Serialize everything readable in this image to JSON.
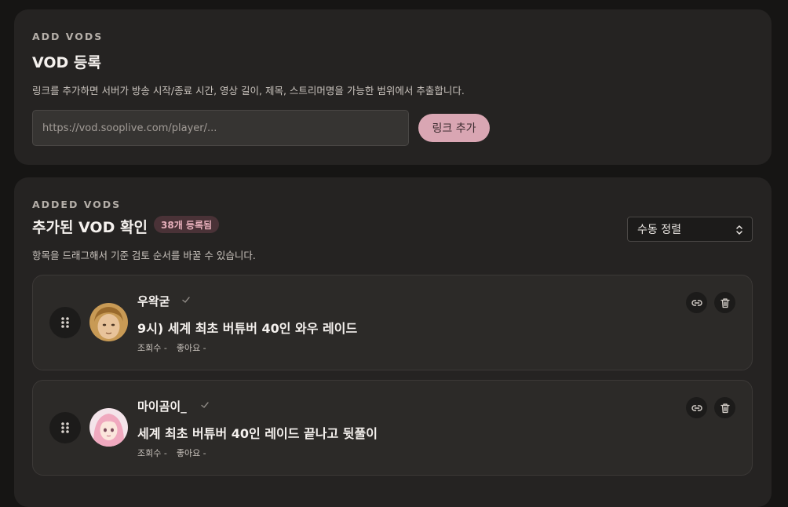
{
  "add_section": {
    "eyebrow": "ADD VODS",
    "title": "VOD 등록",
    "description": "링크를 추가하면 서버가 방송 시작/종료 시간, 영상 길이, 제목, 스트리머명을 가능한 범위에서 추출합니다.",
    "url_input": {
      "value": "",
      "placeholder": "https://vod.sooplive.com/player/..."
    },
    "add_button_label": "링크 추가"
  },
  "list_section": {
    "eyebrow": "ADDED VODS",
    "title": "추가된 VOD 확인",
    "count_badge": "38개 등록됨",
    "description": "항목을 드래그해서 기준 검토 순서를 바꿀 수 있습니다.",
    "sort_select": {
      "selected": "수동 정렬"
    },
    "items": [
      {
        "streamer": "우왁굳",
        "title": "9시) 세계 최초 버튜버 40인 와우 레이드",
        "views": "조회수 -",
        "likes": "좋아요 -",
        "verified_icon": "check-icon",
        "link_icon": "link-icon",
        "delete_icon": "trash-icon"
      },
      {
        "streamer": "마이곰이_",
        "title": "세계 최초 버튜버 40인 레이드 끝나고 뒷풀이",
        "views": "조회수 -",
        "likes": "좋아요 -",
        "verified_icon": "check-icon",
        "link_icon": "link-icon",
        "delete_icon": "trash-icon"
      }
    ]
  },
  "colors": {
    "background": "#161514",
    "card": "#252322",
    "accent": "#d9a6b3",
    "badge_bg": "#4a3237",
    "badge_text": "#e6aeba"
  }
}
